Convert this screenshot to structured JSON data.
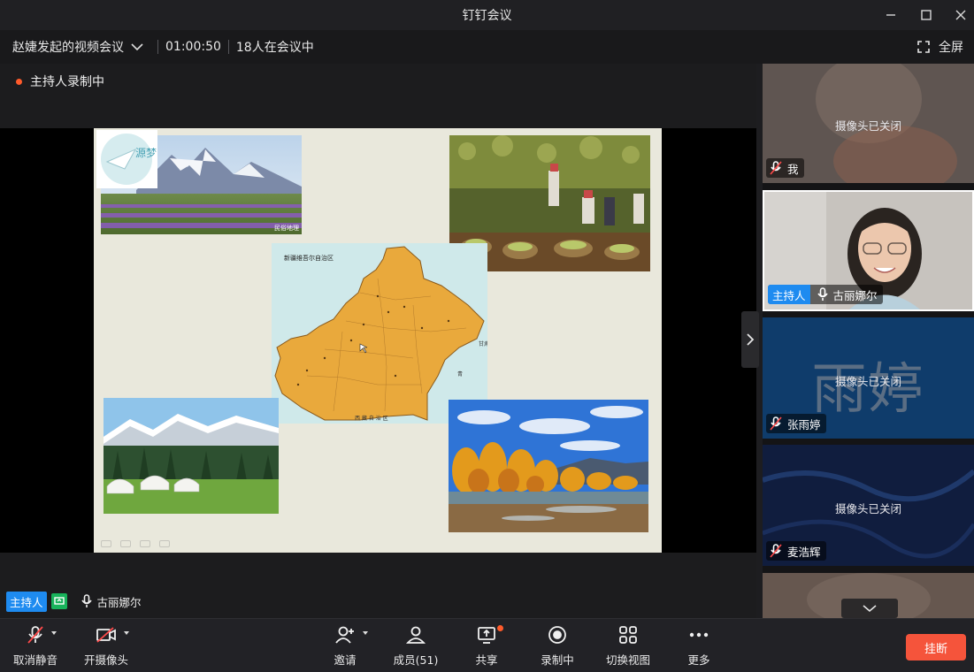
{
  "window": {
    "title": "钉钉会议"
  },
  "info_bar": {
    "meeting_title": "赵婕发起的视频会议",
    "duration": "01:00:50",
    "participants_in_meeting": "18人在会议中",
    "fullscreen_label": "全屏"
  },
  "stage": {
    "recording_status": "主持人录制中",
    "slide": {
      "logo_text": "源梦",
      "map_title": "新疆维吾尔自治区",
      "map_bottom_label": "西 藏 自 治 区",
      "map_side_labels": [
        "甘肃",
        "青"
      ],
      "photo_watermark": "民俗地理"
    },
    "active_speaker": {
      "role_tag": "主持人",
      "name": "古丽娜尔"
    }
  },
  "participants": [
    {
      "name": "我",
      "video_status": "摄像头已关闭",
      "muted": true,
      "host": false
    },
    {
      "name": "古丽娜尔",
      "video_status": "",
      "muted": false,
      "host": true,
      "host_label": "主持人"
    },
    {
      "name": "张雨婷",
      "video_status": "摄像头已关闭",
      "muted": true,
      "host": false,
      "avatar_text": "雨婷"
    },
    {
      "name": "麦浩辉",
      "video_status": "摄像头已关闭",
      "muted": true,
      "host": false
    }
  ],
  "toolbar": {
    "unmute": "取消静音",
    "camera_on": "开摄像头",
    "invite": "邀请",
    "members": "成员(51)",
    "share": "共享",
    "recording": "录制中",
    "switch_view": "切换视图",
    "more": "更多",
    "hangup": "挂断"
  },
  "colors": {
    "accent_blue": "#1e8bf0",
    "hangup_red": "#f5543b",
    "record_dot": "#ff5b2b",
    "share_green": "#18b35b",
    "map_fill": "#e9a93c"
  }
}
